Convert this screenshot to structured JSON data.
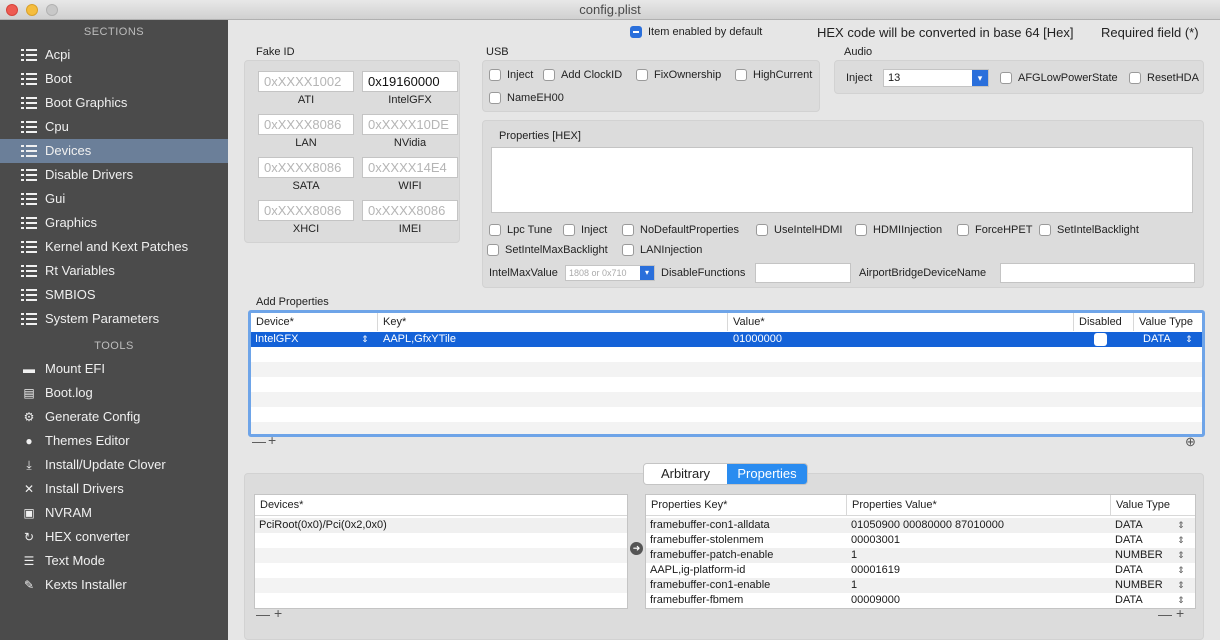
{
  "window": {
    "title": "config.plist"
  },
  "sidebar": {
    "sections_header": "SECTIONS",
    "sections": [
      {
        "label": "Acpi",
        "icon": "list-icon"
      },
      {
        "label": "Boot",
        "icon": "list-icon"
      },
      {
        "label": "Boot Graphics",
        "icon": "list-icon"
      },
      {
        "label": "Cpu",
        "icon": "list-icon"
      },
      {
        "label": "Devices",
        "icon": "list-icon",
        "selected": true
      },
      {
        "label": "Disable Drivers",
        "icon": "list-icon"
      },
      {
        "label": "Gui",
        "icon": "list-icon"
      },
      {
        "label": "Graphics",
        "icon": "list-icon"
      },
      {
        "label": "Kernel and Kext Patches",
        "icon": "list-icon"
      },
      {
        "label": "Rt Variables",
        "icon": "list-icon"
      },
      {
        "label": "SMBIOS",
        "icon": "list-icon"
      },
      {
        "label": "System Parameters",
        "icon": "list-icon"
      }
    ],
    "tools_header": "TOOLS",
    "tools": [
      {
        "label": "Mount EFI",
        "icon": "drive-icon",
        "glyph": "▬"
      },
      {
        "label": "Boot.log",
        "icon": "document-icon",
        "glyph": "▤"
      },
      {
        "label": "Generate Config",
        "icon": "gears-icon",
        "glyph": "⚙"
      },
      {
        "label": "Themes Editor",
        "icon": "palette-icon",
        "glyph": "●"
      },
      {
        "label": "Install/Update Clover",
        "icon": "download-icon",
        "glyph": "⤓"
      },
      {
        "label": "Install Drivers",
        "icon": "tools-icon",
        "glyph": "✕"
      },
      {
        "label": "NVRAM",
        "icon": "chip-icon",
        "glyph": "▣"
      },
      {
        "label": "HEX converter",
        "icon": "convert-icon",
        "glyph": "↻"
      },
      {
        "label": "Text Mode",
        "icon": "text-icon",
        "glyph": "☰"
      },
      {
        "label": "Kexts Installer",
        "icon": "plugin-icon",
        "glyph": "✎"
      }
    ]
  },
  "header": {
    "enabled_note": "Item enabled by default",
    "hex_note": "HEX code will be converted in base 64 [Hex]",
    "required_note": "Required field (*)"
  },
  "fake_id": {
    "title": "Fake ID",
    "fields": [
      {
        "label": "ATI",
        "value": "",
        "placeholder": "0xXXXX1002"
      },
      {
        "label": "IntelGFX",
        "value": "0x19160000",
        "placeholder": ""
      },
      {
        "label": "LAN",
        "value": "",
        "placeholder": "0xXXXX8086"
      },
      {
        "label": "NVidia",
        "value": "",
        "placeholder": "0xXXXX10DE"
      },
      {
        "label": "SATA",
        "value": "",
        "placeholder": "0xXXXX8086"
      },
      {
        "label": "WIFI",
        "value": "",
        "placeholder": "0xXXXX14E4"
      },
      {
        "label": "XHCI",
        "value": "",
        "placeholder": "0xXXXX8086"
      },
      {
        "label": "IMEI",
        "value": "",
        "placeholder": "0xXXXX8086"
      }
    ]
  },
  "usb": {
    "title": "USB",
    "options": [
      "Inject",
      "Add ClockID",
      "FixOwnership",
      "HighCurrent",
      "NameEH00"
    ]
  },
  "audio": {
    "title": "Audio",
    "inject_label": "Inject",
    "inject_value": "13",
    "options": [
      "AFGLowPowerState",
      "ResetHDA"
    ]
  },
  "properties_hex": {
    "title": "Properties [HEX]",
    "options": [
      "Lpc Tune",
      "Inject",
      "NoDefaultProperties",
      "UseIntelHDMI",
      "HDMIInjection",
      "ForceHPET",
      "SetIntelBacklight",
      "SetIntelMaxBacklight",
      "LANInjection"
    ],
    "intel_max_label": "IntelMaxValue",
    "intel_max_placeholder": "1808 or 0x710",
    "disable_functions_label": "DisableFunctions",
    "airport_label": "AirportBridgeDeviceName"
  },
  "add_properties": {
    "title": "Add Properties",
    "columns": [
      "Device*",
      "Key*",
      "Value*",
      "Disabled",
      "Value Type"
    ],
    "rows": [
      {
        "device": "IntelGFX",
        "key": "AAPL,GfxYTile",
        "value": "01000000",
        "type": "DATA"
      }
    ]
  },
  "segmented": {
    "options": [
      "Arbitrary",
      "Properties"
    ],
    "selected": "Properties"
  },
  "devices_table": {
    "column": "Devices*",
    "rows": [
      "PciRoot(0x0)/Pci(0x2,0x0)"
    ]
  },
  "props_table": {
    "columns": [
      "Properties Key*",
      "Properties Value*",
      "Value Type"
    ],
    "rows": [
      {
        "key": "framebuffer-con1-alldata",
        "value": "01050900 00080000 87010000",
        "type": "DATA"
      },
      {
        "key": "framebuffer-stolenmem",
        "value": "00003001",
        "type": "DATA"
      },
      {
        "key": "framebuffer-patch-enable",
        "value": "1",
        "type": "NUMBER"
      },
      {
        "key": "AAPL,ig-platform-id",
        "value": "00001619",
        "type": "DATA"
      },
      {
        "key": "framebuffer-con1-enable",
        "value": "1",
        "type": "NUMBER"
      },
      {
        "key": "framebuffer-fbmem",
        "value": "00009000",
        "type": "DATA"
      }
    ]
  },
  "controls": {
    "minus": "—",
    "plus": "+"
  }
}
